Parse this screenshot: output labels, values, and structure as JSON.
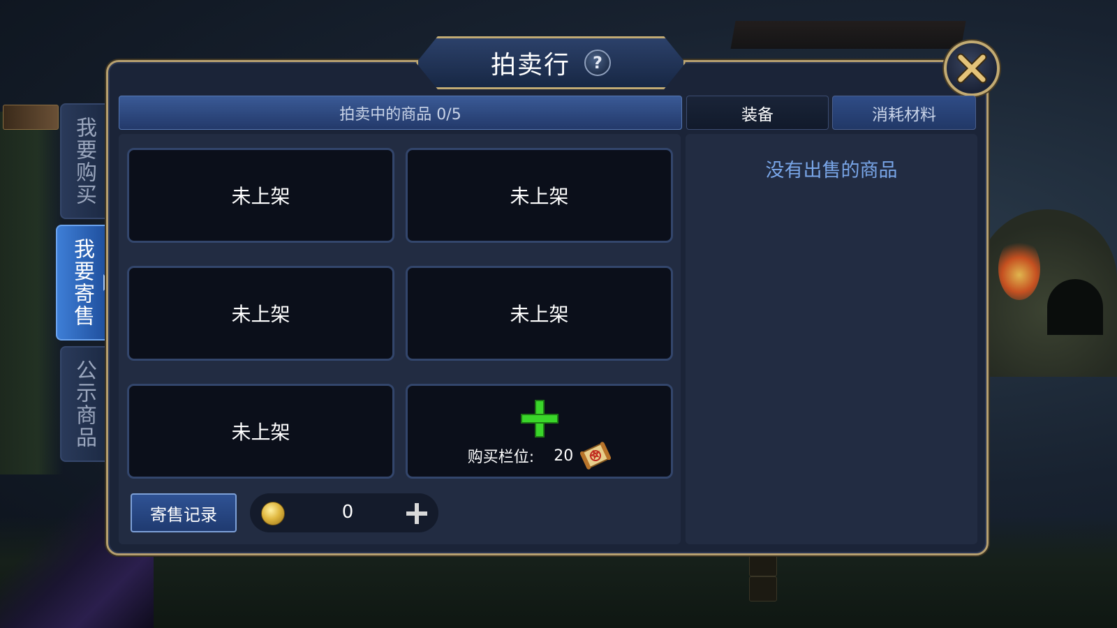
{
  "window": {
    "title": "拍卖行"
  },
  "side_tabs": [
    {
      "label": "我要购买",
      "active": false
    },
    {
      "label": "我要寄售",
      "active": true
    },
    {
      "label": "公示商品",
      "active": false
    }
  ],
  "header": {
    "selling_label": "拍卖中的商品 0/5",
    "category_tabs": [
      {
        "label": "装备",
        "active": true
      },
      {
        "label": "消耗材料",
        "active": false
      }
    ]
  },
  "slots": [
    {
      "label": "未上架"
    },
    {
      "label": "未上架"
    },
    {
      "label": "未上架"
    },
    {
      "label": "未上架"
    },
    {
      "label": "未上架"
    }
  ],
  "buy_slot": {
    "label": "购买栏位:",
    "value": "20"
  },
  "footer": {
    "record_button": "寄售记录",
    "coin_value": "0"
  },
  "right_panel": {
    "empty_message": "没有出售的商品"
  },
  "colors": {
    "accent_blue": "#3e7ed6",
    "gold_border": "#b7a070",
    "plus_green": "#3ad62a",
    "empty_text": "#79a6e8"
  },
  "icons": [
    "help-icon",
    "close-icon",
    "plus-icon",
    "scroll-icon",
    "coin-icon",
    "add-coin-icon"
  ]
}
